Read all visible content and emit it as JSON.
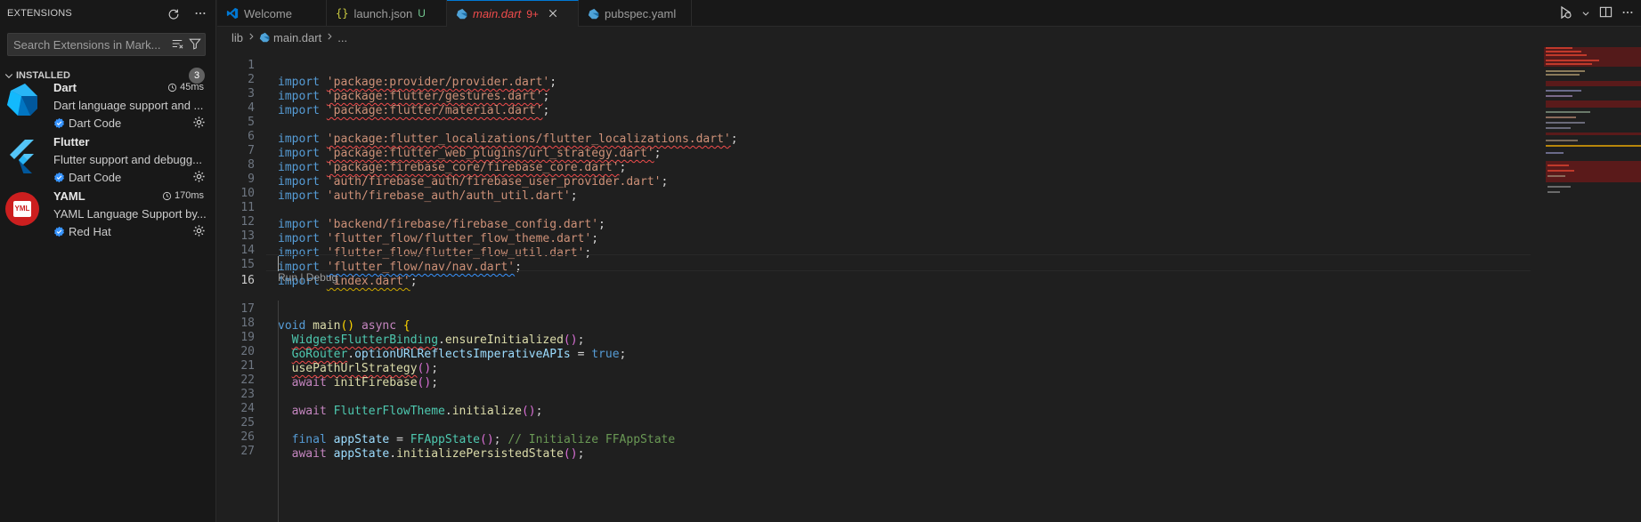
{
  "sidebar": {
    "title": "EXTENSIONS",
    "search": {
      "placeholder": "Search Extensions in Mark...",
      "value": ""
    },
    "section": {
      "label": "INSTALLED",
      "count": "3"
    },
    "extensions": [
      {
        "name": "Dart",
        "time": "45ms",
        "description": "Dart language support and ...",
        "publisher": "Dart Code",
        "verified": true
      },
      {
        "name": "Flutter",
        "time": "",
        "description": "Flutter support and debugg...",
        "publisher": "Dart Code",
        "verified": true
      },
      {
        "name": "YAML",
        "time": "170ms",
        "description": "YAML Language Support by...",
        "publisher": "Red Hat",
        "verified": true,
        "logo_text": "YML"
      }
    ]
  },
  "tabs": [
    {
      "label": "Welcome",
      "icon": "vscode-icon",
      "active": false
    },
    {
      "label": "launch.json",
      "icon": "json-braces-icon",
      "badge": "U",
      "active": false
    },
    {
      "label": "main.dart",
      "icon": "dart-icon",
      "badge": "9+",
      "active": true
    },
    {
      "label": "pubspec.yaml",
      "icon": "dart-icon",
      "active": false
    }
  ],
  "breadcrumb": {
    "folder": "lib",
    "file": "main.dart",
    "more": "..."
  },
  "editor": {
    "codelens": "Run | Debug",
    "cursor_line": 16,
    "line_numbers": [
      "1",
      "2",
      "3",
      "4",
      "5",
      "6",
      "7",
      "8",
      "9",
      "10",
      "11",
      "12",
      "13",
      "14",
      "15",
      "16",
      "17",
      "18",
      "19",
      "20",
      "21",
      "22",
      "23",
      "24",
      "25",
      "26",
      "27"
    ],
    "tokens": {
      "import": "import",
      "l1": "'package:provider/provider.dart'",
      "l2": "'package:flutter/gestures.dart'",
      "l3": "'package:flutter/material.dart'",
      "l5": "'package:flutter_localizations/flutter_localizations.dart'",
      "l6": "'package:flutter_web_plugins/url_strategy.dart'",
      "l7": "'package:firebase_core/firebase_core.dart'",
      "l8": "'auth/firebase_auth/firebase_user_provider.dart'",
      "l9": "'auth/firebase_auth/auth_util.dart'",
      "l11": "'backend/firebase/firebase_config.dart'",
      "l12": "'flutter_flow/flutter_flow_theme.dart'",
      "l13": "'flutter_flow/flutter_flow_util.dart'",
      "l14": "'flutter_flow/nav/nav.dart'",
      "l15": "'index.dart'",
      "semi": ";",
      "void": "void",
      "main": "main",
      "async": "async",
      "await": "await",
      "final": "final",
      "true": "true",
      "widgetsBinding": "WidgetsFlutterBinding",
      "ensureInitialized": "ensureInitialized",
      "goRouter": "GoRouter",
      "optionURL": "optionURLReflectsImperativeAPIs",
      "usePathUrlStrategy": "usePathUrlStrategy",
      "initFirebase": "initFirebase",
      "ffTheme": "FlutterFlowTheme",
      "initialize": "initialize",
      "appState": "appState",
      "ffAppState": "FFAppState",
      "comment": "// Initialize FFAppState",
      "initPersisted": "initializePersistedState"
    }
  },
  "colors": {
    "accent": "#0078d4",
    "error": "#f14c4c",
    "modified": "#73c991",
    "dart_blue": "#0175c2",
    "yaml_red": "#cc1f1f"
  }
}
